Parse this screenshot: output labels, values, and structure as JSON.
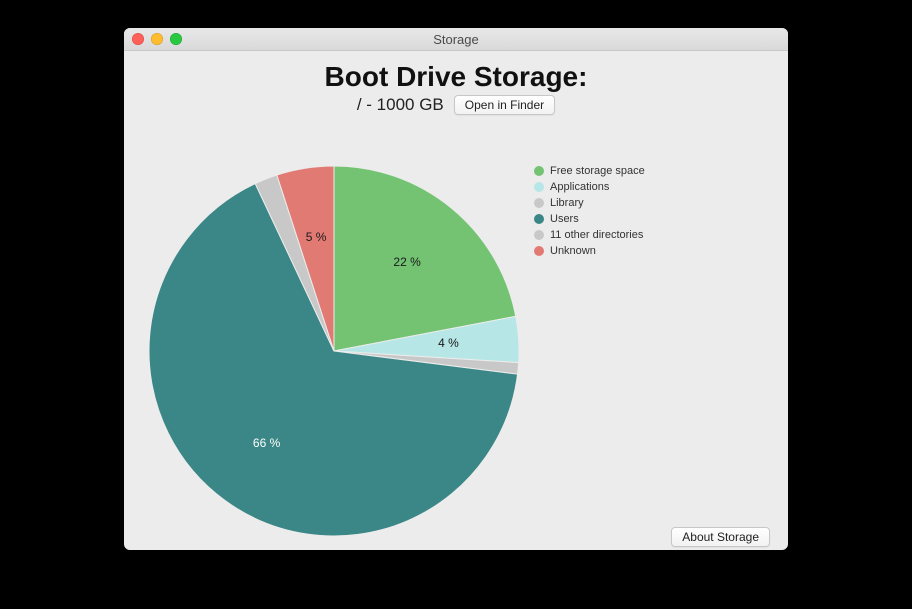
{
  "window": {
    "title": "Storage"
  },
  "header": {
    "title": "Boot Drive Storage:",
    "path_size": "/ - 1000 GB",
    "open_finder_label": "Open in Finder"
  },
  "footer": {
    "about_label": "About Storage"
  },
  "chart_data": {
    "type": "pie",
    "title": "Boot Drive Storage:",
    "series": [
      {
        "name": "Free storage space",
        "value": 22,
        "color": "#73c373",
        "label": "22 %",
        "show_label": true,
        "label_light": false
      },
      {
        "name": "Applications",
        "value": 4,
        "color": "#b7e6e6",
        "label": "4 %",
        "show_label": true,
        "label_light": false
      },
      {
        "name": "Library",
        "value": 1,
        "color": "#c8c8c8",
        "label": "",
        "show_label": false,
        "label_light": false
      },
      {
        "name": "Users",
        "value": 66,
        "color": "#3b8686",
        "label": "66 %",
        "show_label": true,
        "label_light": true
      },
      {
        "name": "11 other directories",
        "value": 2,
        "color": "#c8c8c8",
        "label": "",
        "show_label": false,
        "label_light": false
      },
      {
        "name": "Unknown",
        "value": 5,
        "color": "#e27a74",
        "label": "5 %",
        "show_label": true,
        "label_light": false
      }
    ]
  }
}
